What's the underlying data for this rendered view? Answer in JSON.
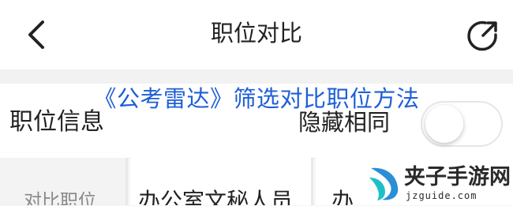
{
  "navbar": {
    "title": "职位对比",
    "back_icon": "chevron-left-icon",
    "share_icon": "share-external-icon"
  },
  "overlay": {
    "title": "《公考雷达》筛选对比职位方法",
    "color": "#1e5fd6"
  },
  "section": {
    "title": "职位信息",
    "hide_same_label": "隐藏相同",
    "hide_same_toggle": "off"
  },
  "table": {
    "header_cells": [
      "对比职位",
      "办公室文秘人员",
      "办"
    ]
  },
  "watermark": {
    "name": "夹子手游网",
    "url": "jzguide.com"
  }
}
